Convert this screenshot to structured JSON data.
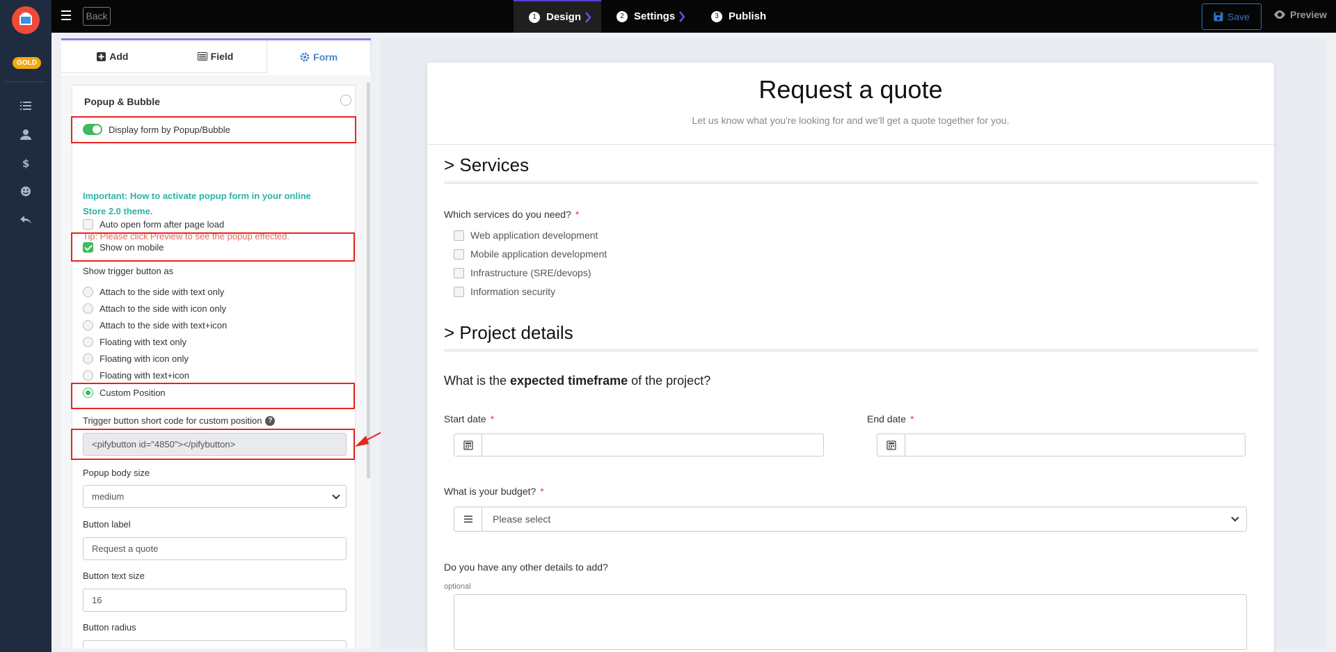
{
  "rail": {
    "badge": "GOLD",
    "icons": [
      "list-icon",
      "user-icon",
      "dollar-icon",
      "smile-icon",
      "reply-icon"
    ]
  },
  "topbar": {
    "back_label": "Back",
    "steps": [
      {
        "num": "1",
        "label": "Design"
      },
      {
        "num": "2",
        "label": "Settings"
      },
      {
        "num": "3",
        "label": "Publish"
      }
    ],
    "save_label": "Save",
    "preview_label": "Preview"
  },
  "panel": {
    "tabs": [
      {
        "label": "Add"
      },
      {
        "label": "Field"
      },
      {
        "label": "Form"
      }
    ],
    "card_title": "Popup & Bubble",
    "display_toggle_label": "Display form by Popup/Bubble",
    "important_text": "Important: How to activate popup form in your online Store 2.0 theme.",
    "tip_text": "Tip: Please click Preview to see the popup effected.",
    "auto_open_label": "Auto open form after page load",
    "show_mobile_label": "Show on mobile",
    "trigger_heading": "Show trigger button as",
    "trigger_options": [
      "Attach to the side with text only",
      "Attach to the side with icon only",
      "Attach to the side with text+icon",
      "Floating with text only",
      "Floating with icon only",
      "Floating with text+icon",
      "Custom Position"
    ],
    "shortcode_label": "Trigger button short code for custom position",
    "shortcode_value": "<pifybutton id=\"4850\"></pifybutton>",
    "popup_size_label": "Popup body size",
    "popup_size_value": "medium",
    "button_label_label": "Button label",
    "button_label_placeholder": "Request a quote",
    "button_text_size_label": "Button text size",
    "button_text_size_value": "16",
    "button_radius_label": "Button radius"
  },
  "form": {
    "title": "Request a quote",
    "subtitle": "Let us know what you're looking for and we'll get a quote together for you.",
    "section1": "> Services",
    "services_question": "Which services do you need?",
    "services": [
      "Web application development",
      "Mobile application development",
      "Infrastructure (SRE/devops)",
      "Information security"
    ],
    "section2": "> Project details",
    "timeframe_pre": "What is the ",
    "timeframe_bold": "expected timeframe",
    "timeframe_post": " of the project?",
    "start_date_label": "Start date",
    "end_date_label": "End date",
    "budget_label": "What is your budget?",
    "budget_value": "Please select",
    "details_label": "Do you have any other details to add?",
    "optional_note": "optional",
    "required_mark": "*"
  }
}
